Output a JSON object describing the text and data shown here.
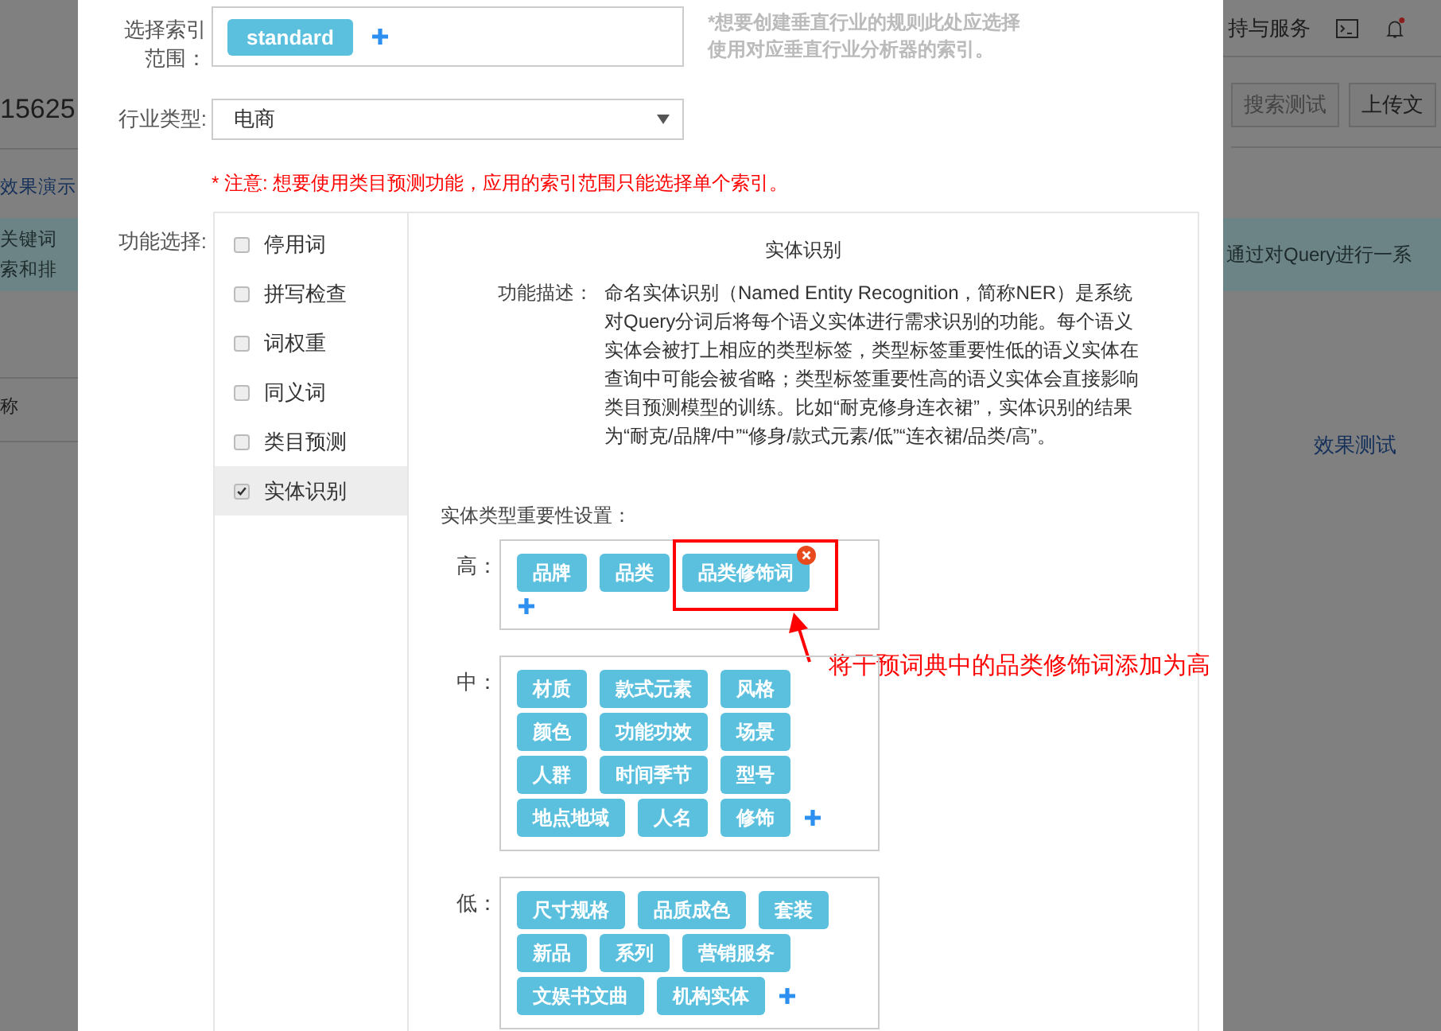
{
  "background": {
    "left": {
      "id_text": "15625",
      "link": "效果演示",
      "banner_lines": [
        "关键词",
        "索和排"
      ],
      "column_header": "称"
    },
    "right": {
      "nav_text": "持与服务",
      "notification_dot": true,
      "buttons": [
        "搜索测试",
        "上传文"
      ],
      "banner_text": "通过对Query进行一系",
      "link": "效果测试"
    }
  },
  "dialog": {
    "index_scope": {
      "label": "选择索引范围：",
      "tags": [
        "standard"
      ],
      "hint_lines": [
        "*想要创建垂直行业的规则此处应选择",
        "使用对应垂直行业分析器的索引。"
      ]
    },
    "industry": {
      "label": "行业类型:",
      "value": "电商"
    },
    "notice": "* 注意: 想要使用类目预测功能，应用的索引范围只能选择单个索引。",
    "features": {
      "label": "功能选择:",
      "items": [
        {
          "label": "停用词",
          "checked": false,
          "selected": false
        },
        {
          "label": "拼写检查",
          "checked": false,
          "selected": false
        },
        {
          "label": "词权重",
          "checked": false,
          "selected": false
        },
        {
          "label": "同义词",
          "checked": false,
          "selected": false
        },
        {
          "label": "类目预测",
          "checked": false,
          "selected": false
        },
        {
          "label": "实体识别",
          "checked": true,
          "selected": true
        }
      ]
    },
    "detail": {
      "title": "实体识别",
      "description_label": "功能描述：",
      "description": "命名实体识别（Named Entity Recognition，简称NER）是系统对Query分词后将每个语义实体进行需求识别的功能。每个语义实体会被打上相应的类型标签，类型标签重要性低的语义实体在查询中可能会被省略；类型标签重要性高的语义实体会直接影响类目预测模型的训练。比如“耐克修身连衣裙”，实体识别的结果为“耐克/品牌/中”“修身/款式元素/低”“连衣裙/品类/高”。",
      "importance_title": "实体类型重要性设置：",
      "levels": [
        {
          "label": "高：",
          "tags": [
            {
              "text": "品牌",
              "removable": false,
              "highlighted": false
            },
            {
              "text": "品类",
              "removable": false,
              "highlighted": false
            },
            {
              "text": "品类修饰词",
              "removable": true,
              "highlighted": true
            }
          ],
          "annotation": "将干预词典中的品类修饰词添加为高"
        },
        {
          "label": "中：",
          "tags": [
            {
              "text": "材质",
              "removable": false,
              "highlighted": false
            },
            {
              "text": "款式元素",
              "removable": false,
              "highlighted": false
            },
            {
              "text": "风格",
              "removable": false,
              "highlighted": false
            },
            {
              "text": "颜色",
              "removable": false,
              "highlighted": false
            },
            {
              "text": "功能功效",
              "removable": false,
              "highlighted": false
            },
            {
              "text": "场景",
              "removable": false,
              "highlighted": false
            },
            {
              "text": "人群",
              "removable": false,
              "highlighted": false
            },
            {
              "text": "时间季节",
              "removable": false,
              "highlighted": false
            },
            {
              "text": "型号",
              "removable": false,
              "highlighted": false
            },
            {
              "text": "地点地域",
              "removable": false,
              "highlighted": false
            },
            {
              "text": "人名",
              "removable": false,
              "highlighted": false
            },
            {
              "text": "修饰",
              "removable": false,
              "highlighted": false
            }
          ]
        },
        {
          "label": "低：",
          "tags": [
            {
              "text": "尺寸规格",
              "removable": false,
              "highlighted": false
            },
            {
              "text": "品质成色",
              "removable": false,
              "highlighted": false
            },
            {
              "text": "套装",
              "removable": false,
              "highlighted": false
            },
            {
              "text": "新品",
              "removable": false,
              "highlighted": false
            },
            {
              "text": "系列",
              "removable": false,
              "highlighted": false
            },
            {
              "text": "营销服务",
              "removable": false,
              "highlighted": false
            },
            {
              "text": "文娱书文曲",
              "removable": false,
              "highlighted": false
            },
            {
              "text": "机构实体",
              "removable": false,
              "highlighted": false
            }
          ]
        }
      ]
    }
  }
}
